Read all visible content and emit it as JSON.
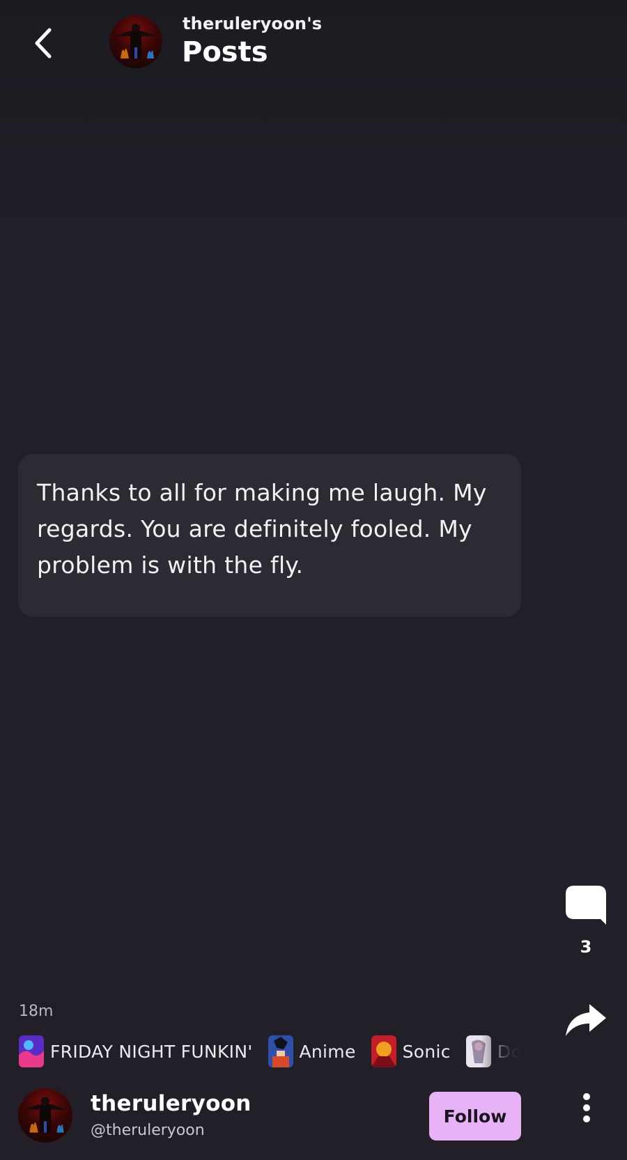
{
  "header": {
    "subtitle": "theruleryoon's",
    "title": "Posts"
  },
  "post": {
    "text": "Thanks to all for making me laugh. My regards. You are definitely fooled. My problem is with the fly."
  },
  "actions": {
    "comment_count": "3"
  },
  "meta": {
    "time_ago": "18m"
  },
  "communities": [
    {
      "name": "FRIDAY NIGHT FUNKIN'"
    },
    {
      "name": "Anime"
    },
    {
      "name": "Sonic"
    },
    {
      "name": "Do"
    }
  ],
  "author": {
    "name": "theruleryoon",
    "handle": "@theruleryoon",
    "follow_label": "Follow"
  },
  "colors": {
    "background": "#221f29",
    "card": "#2c2a33",
    "follow_button": "#e8b2f7"
  }
}
